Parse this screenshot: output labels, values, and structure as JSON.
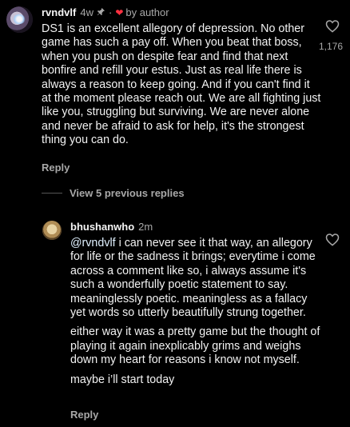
{
  "comment": {
    "username": "rvndvlf",
    "time": "4w",
    "by_author": "by author",
    "text": "DS1 is an excellent allegory of depression. No other game has such a pay off. When you beat that boss, when you push on despite fear and find that next bonfire and refill your estus. Just as real life there is always a reason to keep going. And if you can't find it at the moment please reach out. We are all fighting just like you, struggling but surviving. We are never alone and never be afraid to ask for help, it's the strongest thing you can do.",
    "reply_label": "Reply",
    "like_count": "1,176"
  },
  "view_replies": "View 5 previous replies",
  "reply": {
    "username": "bhushanwho",
    "time": "2m",
    "mention": "@rvndvlf",
    "paragraph_1": " i can never see it that way, an allegory for life or the sadness it brings; everytime i come across a comment like so, i always assume it's such a wonderfully poetic statement to say. meaninglessly poetic. meaningless as a fallacy yet words so utterly beautifully strung together.",
    "paragraph_2": "either way it was a pretty game but the thought of playing it again inexplicably grims and weighs down my heart for reasons i know not myself.",
    "paragraph_3": "maybe i’ll start today",
    "reply_label": "Reply"
  },
  "colors": {
    "background": "#000000",
    "text": "#f2f2f2",
    "muted": "#a8a8a8",
    "heart_red": "#ff3040",
    "mention": "#e0f1ff"
  }
}
